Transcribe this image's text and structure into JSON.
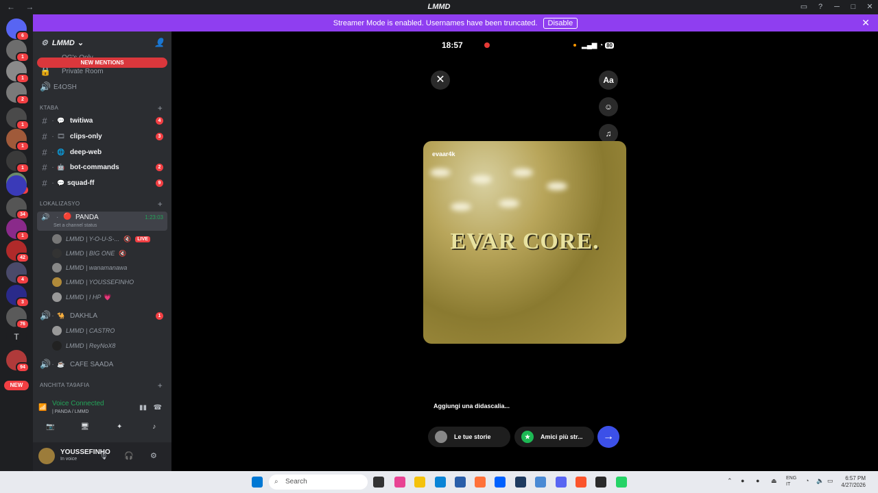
{
  "window": {
    "title": "LMMD",
    "back_glyph": "←",
    "forward_glyph": "→"
  },
  "banner": {
    "text": "Streamer Mode is enabled. Usernames have been truncated.",
    "disable_label": "Disable"
  },
  "guild_badges": [
    "6",
    "1",
    "1",
    "2",
    "1",
    "1",
    "1",
    "28",
    "1",
    "34",
    "1",
    "42",
    "4",
    "3",
    "76",
    "94"
  ],
  "guild_new_label": "NEW",
  "server": {
    "name": "LMMD",
    "new_mentions_label": "NEW MENTIONS",
    "top_channels": [
      "OG's Only",
      "Private Room",
      "E4OSH"
    ],
    "categories": [
      "KTABA",
      "LOKALIZASYO",
      "ANCHITA TA9AFIA"
    ],
    "text_channels": [
      {
        "name": "twitiwa",
        "badge": "4"
      },
      {
        "name": "clips-only",
        "badge": "3"
      },
      {
        "name": "deep-web",
        "badge": ""
      },
      {
        "name": "bot-commands",
        "badge": "2"
      },
      {
        "name": "squad-ff",
        "badge": "9"
      }
    ],
    "voice_channel_active": {
      "name": "PANDA",
      "status": "Set a channel status",
      "time": "1:23:03"
    },
    "voice_members": [
      {
        "name": "LMMD | Y-O-U-S-...",
        "live": "LIVE"
      },
      {
        "name": "LMMD | BIG ONE",
        "live": ""
      },
      {
        "name": "LMMD | wanamanawa",
        "live": ""
      },
      {
        "name": "LMMD | YOUSSEFINHO",
        "live": ""
      },
      {
        "name": "LMMD | I HP",
        "live": ""
      }
    ],
    "voice_channel_2": {
      "name": "DAKHLA",
      "badge": "1"
    },
    "voice_members_2": [
      {
        "name": "LMMD | CASTRO"
      },
      {
        "name": "LMMD | ReyNoX8"
      }
    ],
    "voice_channel_3": {
      "name": "CAFE SAADA"
    }
  },
  "voice": {
    "status": "Voice Connected",
    "location": "| PANDA / LMMD"
  },
  "user": {
    "name": "YOUSSEFINHO",
    "status": "In voice"
  },
  "story": {
    "time": "18:57",
    "battery": "80",
    "username": "evaar4k",
    "overlay_text": "EVAR CORE.",
    "text_tool": "Aa",
    "caption_placeholder": "Aggiungi una didascalia...",
    "your_stories_label": "Le tue storie",
    "close_friends_label": "Amici più str...",
    "send_glyph": "→"
  },
  "taskbar": {
    "search_label": "Search",
    "time": "6:57 PM",
    "date": "4/27/2026",
    "lang1": "ENG",
    "lang2": "IT"
  },
  "colors": {
    "banner": "#8f3ef0",
    "accent_red": "#f23f43",
    "voice_green": "#23a559",
    "send_blue": "#3c50e8"
  }
}
